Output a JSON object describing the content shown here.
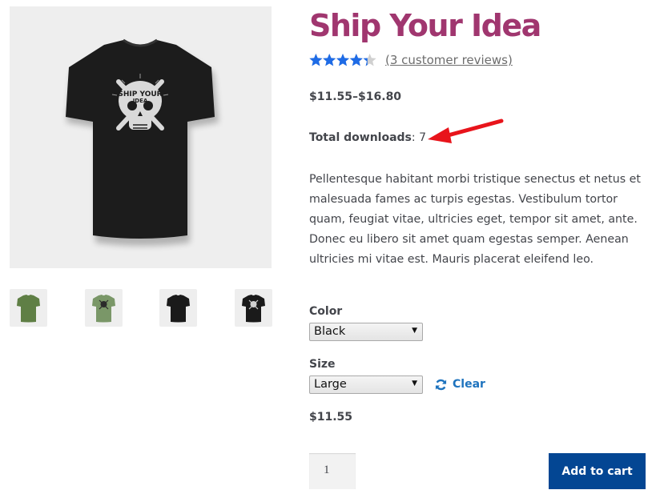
{
  "product": {
    "title": "Ship Your Idea",
    "rating": {
      "value": 4.33,
      "max": 5
    },
    "reviews_link": "(3 customer reviews)",
    "price_range": "$11.55–$16.80",
    "downloads": {
      "label": "Total downloads",
      "separator": ": ",
      "value": "7"
    },
    "description": "Pellentesque habitant morbi tristique senectus et netus et malesuada fames ac turpis egestas. Vestibulum tortor quam, feugiat vitae, ultricies eget, tempor sit amet, ante. Donec eu libero sit amet quam egestas semper. Aenean ultricies mi vitae est. Mauris placerat eleifend leo."
  },
  "gallery": {
    "main_image": "black-tshirt-skull-print",
    "thumbnails": [
      {
        "name": "green-tshirt-plain",
        "color": "#5f7f45"
      },
      {
        "name": "green-tshirt-print",
        "color": "#7a9768"
      },
      {
        "name": "black-tshirt-plain",
        "color": "#1a1a1a"
      },
      {
        "name": "black-tshirt-print",
        "color": "#1a1a1a"
      }
    ]
  },
  "variations": {
    "color": {
      "label": "Color",
      "selected": "Black"
    },
    "size": {
      "label": "Size",
      "selected": "Large"
    },
    "clear_label": "Clear",
    "variation_price": "$11.55"
  },
  "cart": {
    "quantity": "1",
    "add_to_cart_label": "Add to cart"
  },
  "colors": {
    "title": "#a0366f",
    "star": "#1e6be6",
    "star_empty": "#d0d0d0",
    "link": "#1e73be",
    "button": "#034693",
    "annotation_arrow": "#e8141b"
  }
}
